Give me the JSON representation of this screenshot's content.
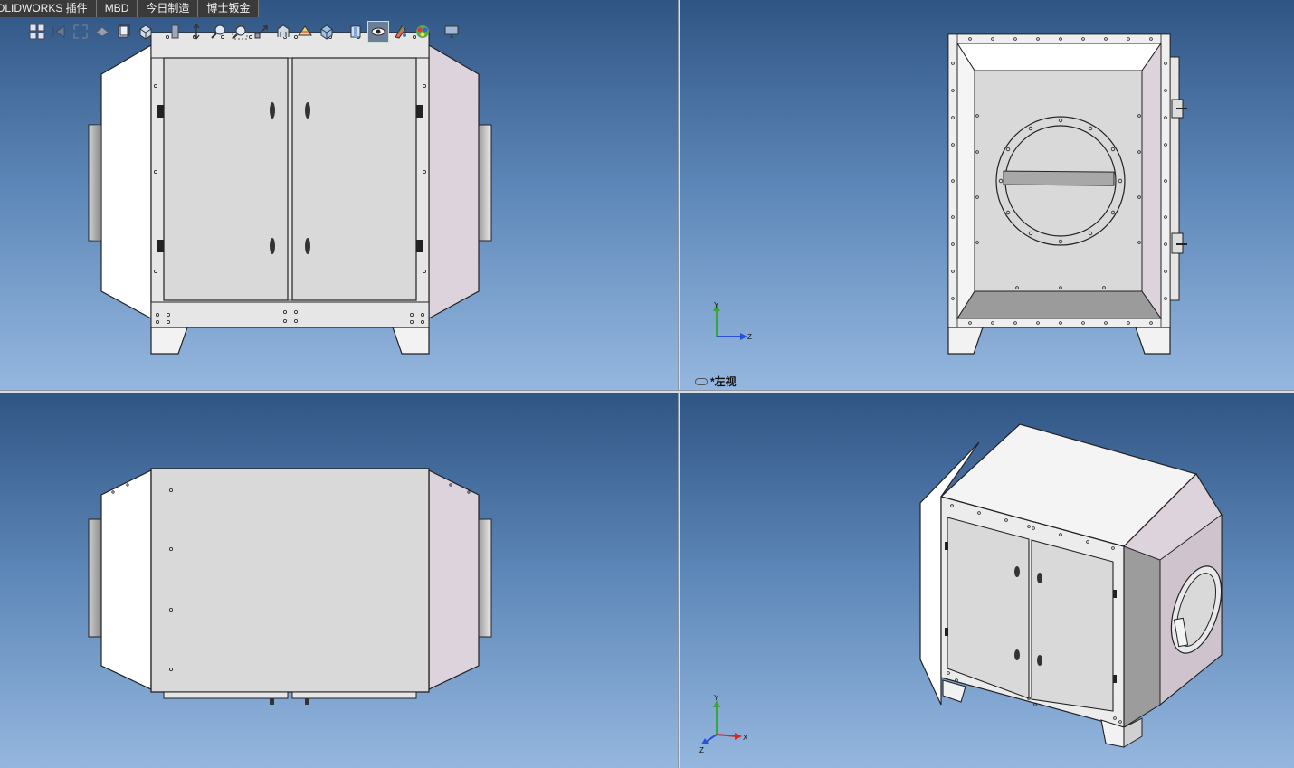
{
  "command_manager": {
    "tabs": [
      {
        "label": "OLIDWORKS 插件"
      },
      {
        "label": "MBD"
      },
      {
        "label": "今日制造"
      },
      {
        "label": "博士钣金"
      }
    ]
  },
  "heads_up_toolbar": {
    "icons": [
      "view-orientation-icon",
      "previous-view-icon",
      "section-view-icon",
      "dynamic-annotation-icon",
      "display-style-icon",
      "hide-show-items-icon",
      "edit-appearance-icon",
      "apply-scene-icon",
      "zoom-to-fit-icon",
      "zoom-to-area-icon",
      "rotate-view-icon",
      "pan-icon",
      "standard-views-icon",
      "isometric-icon",
      "normal-to-icon",
      "view-settings-icon",
      "realview-icon",
      "appearance-icon",
      "monitor-icon"
    ]
  },
  "viewports": {
    "top_right": {
      "view_name": "*左视",
      "triad_axes": {
        "up": "Y",
        "right": "Z"
      }
    },
    "bottom_right": {
      "triad_axes": {
        "up": "Y",
        "right": "X",
        "down_left": "Z"
      }
    }
  },
  "colors": {
    "viewport_top": "#2f5584",
    "viewport_bottom": "#95b7df",
    "body_panel": "#d9d9d9",
    "hood_left": "#ffffff",
    "hood_right": "#ddd3dc",
    "outline": "#222222",
    "triad_y": "#3aa63a",
    "triad_z": "#2a4fd8",
    "triad_x": "#d62828"
  }
}
